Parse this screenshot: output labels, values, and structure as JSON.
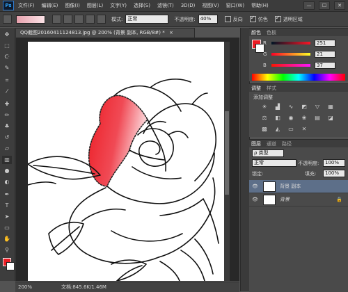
{
  "app": {
    "logo": "Ps"
  },
  "menu": [
    "文件(F)",
    "编辑(E)",
    "图像(I)",
    "图层(L)",
    "文字(Y)",
    "选择(S)",
    "滤镜(T)",
    "3D(D)",
    "视图(V)",
    "窗口(W)",
    "帮助(H)"
  ],
  "window_controls": [
    "—",
    "☐",
    "✕"
  ],
  "options": {
    "mode_label": "模式:",
    "mode_value": "正常",
    "opacity_label": "不透明度:",
    "opacity_value": "40%",
    "reverse_label": "反向",
    "dither_label": "仿色",
    "transparency_label": "透明区域",
    "reverse_checked": false,
    "dither_checked": true,
    "transparency_checked": true
  },
  "document": {
    "tab_title": "QQ截图20160411124813.jpg @ 200% (背景 副本, RGB/8#) *",
    "tab_close": "×"
  },
  "status": {
    "zoom": "200%",
    "doc": "文档:845.6K/1.46M"
  },
  "colors": {
    "foreground": "#ed1c24",
    "background": "#ffffff",
    "accent": "#31a8ff"
  },
  "color_panel": {
    "tabs": [
      "颜色",
      "色板"
    ],
    "channels": [
      {
        "label": "R",
        "value": "251"
      },
      {
        "label": "G",
        "value": "21"
      },
      {
        "label": "B",
        "value": "37"
      }
    ]
  },
  "adjust_panel": {
    "tabs": [
      "调整",
      "样式"
    ],
    "title": "添加调整",
    "icons": [
      "brightness-icon",
      "levels-icon",
      "curves-icon",
      "exposure-icon",
      "vibrance-icon",
      "hsl-icon",
      "colorbalance-icon",
      "bw-icon",
      "photofilter-icon",
      "channelmixer-icon",
      "colorlookup-icon",
      "invert-icon",
      "posterize-icon",
      "threshold-icon",
      "gradientmap-icon",
      "selectivecolor-icon"
    ]
  },
  "layers_panel": {
    "tabs": [
      "图层",
      "通道",
      "路径"
    ],
    "filter_label": "ρ 类型",
    "blend_mode": "正常",
    "opacity_label": "不透明度:",
    "opacity_value": "100%",
    "lock_label": "锁定:",
    "fill_label": "填充:",
    "fill_value": "100%",
    "layers": [
      {
        "name": "背景 副本",
        "selected": true
      },
      {
        "name": "背景",
        "selected": false,
        "locked": true
      }
    ]
  },
  "tools": [
    "move-icon",
    "marquee-icon",
    "lasso-icon",
    "quickselect-icon",
    "crop-icon",
    "eyedropper-icon",
    "healing-icon",
    "brush-icon",
    "clonestamp-icon",
    "history-brush-icon",
    "eraser-icon",
    "gradient-icon",
    "blur-icon",
    "dodge-icon",
    "pen-icon",
    "type-icon",
    "path-select-icon",
    "shape-icon",
    "hand-icon",
    "zoom-icon"
  ]
}
